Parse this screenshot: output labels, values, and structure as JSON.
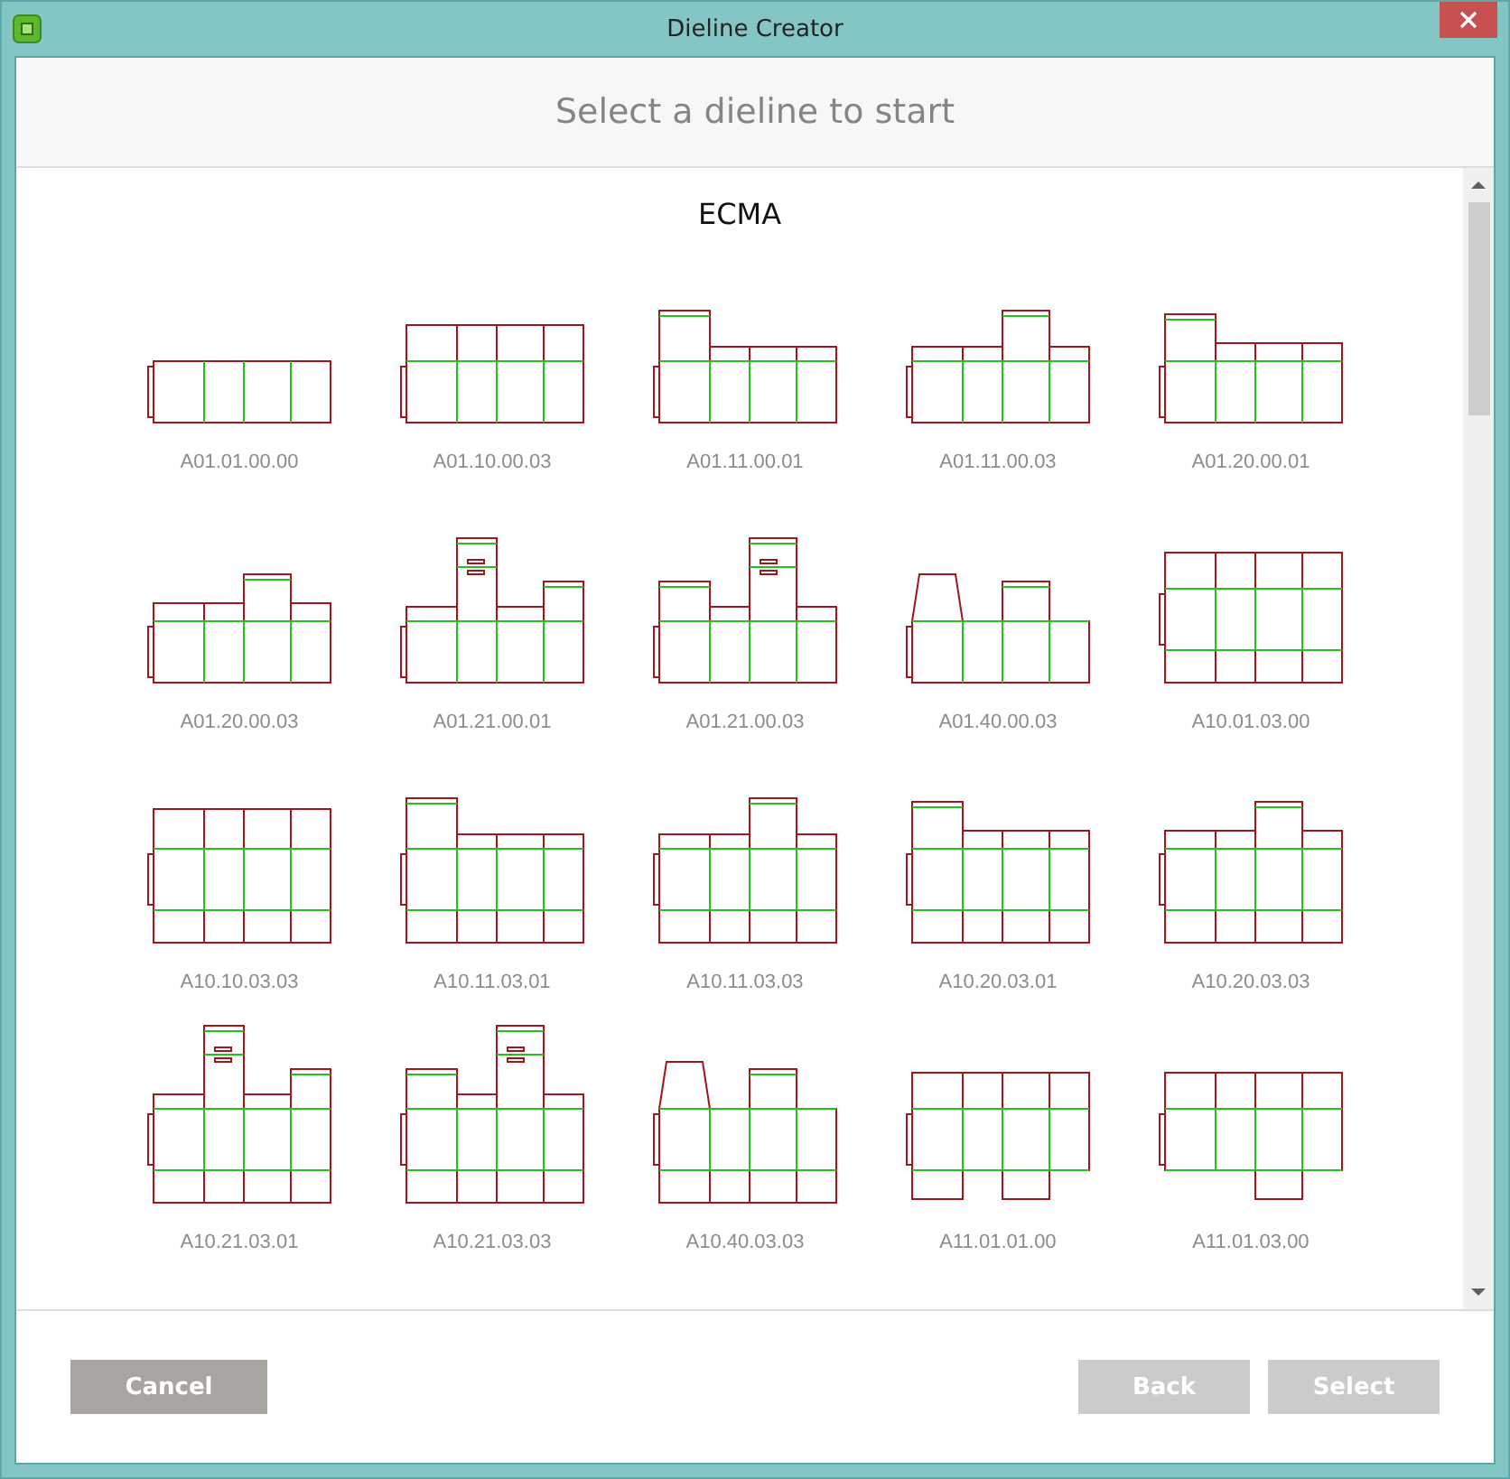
{
  "window": {
    "title": "Dieline Creator"
  },
  "header": {
    "title": "Select a dieline to start"
  },
  "section": {
    "title": "ECMA"
  },
  "dielines": [
    {
      "code": "A01.01.00.00",
      "kind": "strip"
    },
    {
      "code": "A01.10.00.03",
      "kind": "flaps"
    },
    {
      "code": "A01.11.00.01",
      "kind": "raise-left"
    },
    {
      "code": "A01.11.00.03",
      "kind": "raise-mid"
    },
    {
      "code": "A01.20.00.01",
      "kind": "notch-left"
    },
    {
      "code": "A01.20.00.03",
      "kind": "notch-mid"
    },
    {
      "code": "A01.21.00.01",
      "kind": "tuck-left"
    },
    {
      "code": "A01.21.00.03",
      "kind": "tuck-mid"
    },
    {
      "code": "A01.40.00.03",
      "kind": "window"
    },
    {
      "code": "A10.01.03.00",
      "kind": "double"
    },
    {
      "code": "A10.10.03.03",
      "kind": "double-tall"
    },
    {
      "code": "A10.11.03.01",
      "kind": "double-raise-left"
    },
    {
      "code": "A10.11.03.03",
      "kind": "double-raise-mid"
    },
    {
      "code": "A10.20.03.01",
      "kind": "double-notch-left"
    },
    {
      "code": "A10.20.03.03",
      "kind": "double-notch-mid"
    },
    {
      "code": "A10.21.03.01",
      "kind": "double-tuck-left"
    },
    {
      "code": "A10.21.03.03",
      "kind": "double-tuck-mid"
    },
    {
      "code": "A10.40.03.03",
      "kind": "double-window"
    },
    {
      "code": "A11.01.01.00",
      "kind": "shelf"
    },
    {
      "code": "A11.01.03.00",
      "kind": "shelf-mid"
    }
  ],
  "buttons": [
    {
      "label": "Cancel",
      "disabled": false
    },
    {
      "label": "Back",
      "disabled": true
    },
    {
      "label": "Select",
      "disabled": true
    }
  ]
}
